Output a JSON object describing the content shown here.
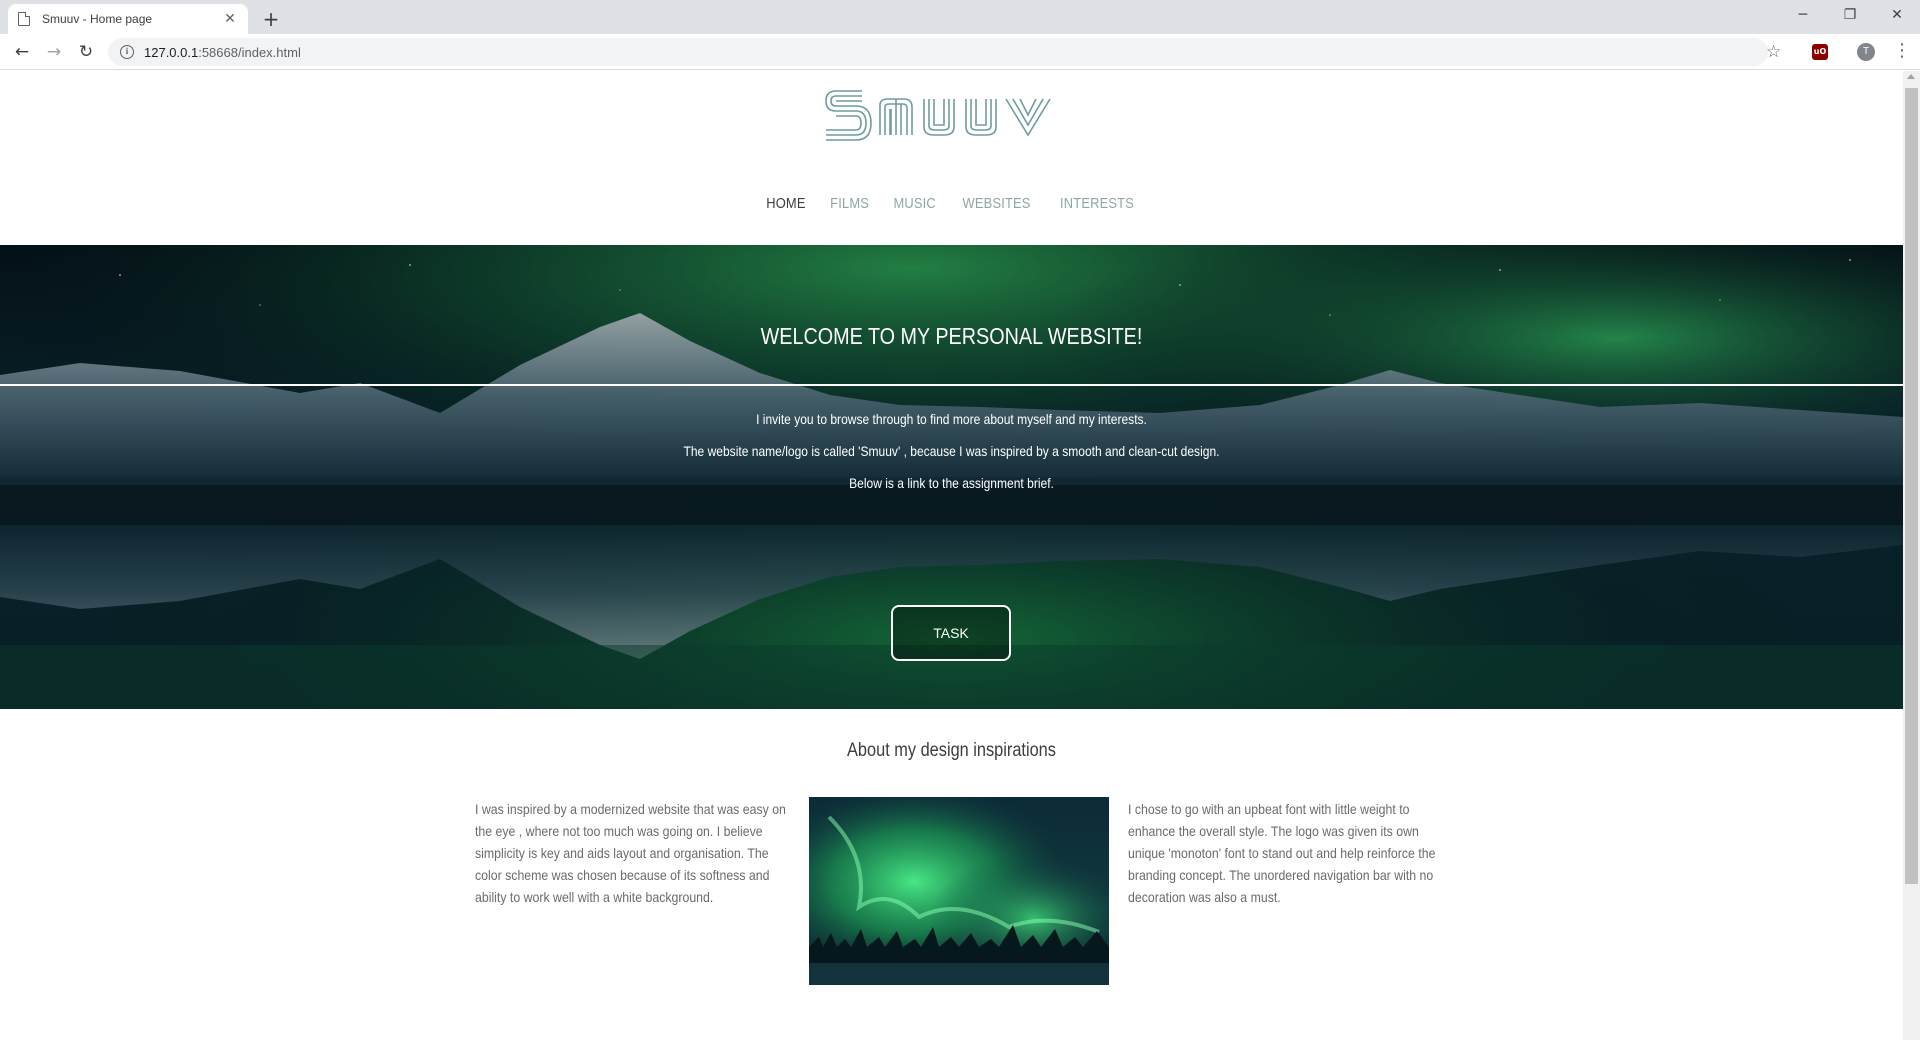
{
  "browser": {
    "tab_title": "Smuuv - Home page",
    "tab_close": "✕",
    "new_tab": "+",
    "url_host": "127.0.0.1",
    "url_path": ":58668/index.html",
    "profile_initial": "T",
    "controls": {
      "minimize": "─",
      "restore": "❐",
      "close": "✕"
    }
  },
  "site": {
    "logo_text": "Smuuv",
    "nav": [
      {
        "label": "HOME",
        "active": true
      },
      {
        "label": "FILMS",
        "active": false
      },
      {
        "label": "MUSIC",
        "active": false
      },
      {
        "label": "WEBSITES",
        "active": false
      },
      {
        "label": "INTERESTS",
        "active": false
      }
    ],
    "hero": {
      "title": "WELCOME TO MY PERSONAL WEBSITE!",
      "line1": "I invite you to browse through to find more about myself and my interests.",
      "line2": "The website name/logo is called 'Smuuv' , because I was inspired by a smooth and clean-cut design.",
      "line3": "Below is a link to the assignment brief.",
      "button": "TASK"
    },
    "about": {
      "title": "About my design inspirations",
      "left_text": "I was inspired by a modernized website that was easy on the eye , where not too much was going on. I believe simplicity is key and aids layout and organisation. The color scheme was chosen because of its softness and ability to work well with a white background.",
      "right_text": "I chose to go with an upbeat font with little weight to enhance the overall style. The logo was given its own unique 'monoton' font to stand out and help reinforce the branding concept. The unordered navigation bar with no decoration was also a must."
    }
  },
  "colors": {
    "logo": "#6f9c9c",
    "nav_inactive": "#8fa6a6",
    "nav_active": "#3d3d3d",
    "body_text": "#6b6b6b"
  }
}
